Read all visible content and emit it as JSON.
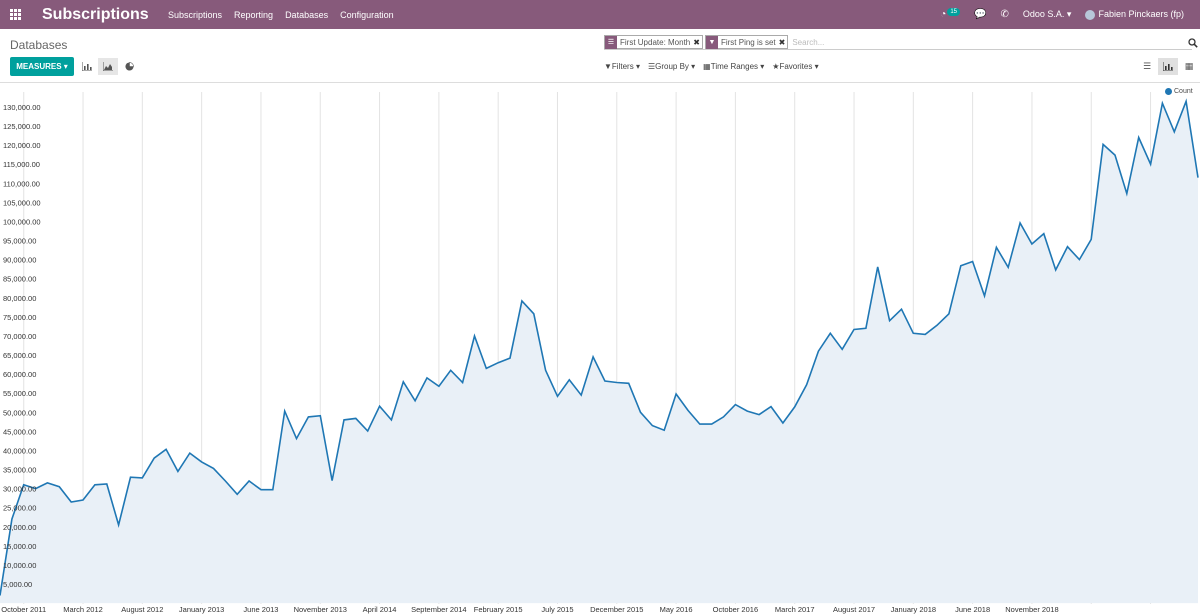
{
  "app": {
    "title": "Subscriptions",
    "menu": [
      "Subscriptions",
      "Reporting",
      "Databases",
      "Configuration"
    ],
    "activity_count": "15",
    "company": "Odoo S.A.",
    "user": "Fabien Pinckaers (fp)"
  },
  "control_panel": {
    "breadcrumb": "Databases",
    "facets": [
      {
        "icon": "menu-icon",
        "value": "First Update: Month"
      },
      {
        "icon": "filter-icon",
        "value": "First Ping is set"
      }
    ],
    "search_placeholder": "Search...",
    "measures_label": "MEASURES",
    "filters_label": "Filters",
    "groupby_label": "Group By",
    "timeranges_label": "Time Ranges",
    "favorites_label": "Favorites"
  },
  "colors": {
    "brand": "#875a7b",
    "accent": "#00a09d",
    "series": "#1f77b4",
    "fill": "#e9f0f7"
  },
  "chart_data": {
    "type": "area",
    "legend": [
      "Count"
    ],
    "legend_position": "top-right",
    "ylim": [
      0,
      132000
    ],
    "yticks": [
      5000,
      10000,
      15000,
      20000,
      25000,
      30000,
      35000,
      40000,
      45000,
      50000,
      55000,
      60000,
      65000,
      70000,
      75000,
      80000,
      85000,
      90000,
      95000,
      100000,
      105000,
      110000,
      115000,
      120000,
      125000,
      130000
    ],
    "ytick_labels": [
      "5,000.00",
      "10,000.00",
      "15,000.00",
      "20,000.00",
      "25,000.00",
      "30,000.00",
      "35,000.00",
      "40,000.00",
      "45,000.00",
      "50,000.00",
      "55,000.00",
      "60,000.00",
      "65,000.00",
      "70,000.00",
      "75,000.00",
      "80,000.00",
      "85,000.00",
      "90,000.00",
      "95,000.00",
      "100,000.00",
      "105,000.00",
      "110,000.00",
      "115,000.00",
      "120,000.00",
      "125,000.00",
      "130,000.00"
    ],
    "x_labels": [
      "October 2011",
      "March 2012",
      "August 2012",
      "January 2013",
      "June 2013",
      "November 2013",
      "April 2014",
      "September 2014",
      "February 2015",
      "July 2015",
      "December 2015",
      "May 2016",
      "October 2016",
      "March 2017",
      "August 2017",
      "January 2018",
      "June 2018",
      "November 2018"
    ],
    "series": [
      {
        "name": "Count",
        "values": [
          2000,
          22000,
          31000,
          30000,
          31500,
          30500,
          26500,
          27000,
          31000,
          31200,
          20500,
          33000,
          32800,
          38000,
          40300,
          34500,
          39300,
          37000,
          35300,
          32000,
          28500,
          32000,
          29700,
          29700,
          50300,
          43100,
          48800,
          49100,
          32100,
          48000,
          48400,
          45100,
          51600,
          48000,
          58000,
          53000,
          59000,
          56800,
          61000,
          57800,
          70000,
          61500,
          63000,
          64200,
          79200,
          75800,
          61000,
          54200,
          58500,
          54500,
          64500,
          58200,
          57800,
          57600,
          50000,
          46500,
          45300,
          54800,
          50500,
          46900,
          46900,
          48800,
          52000,
          50300,
          49400,
          51500,
          47200,
          51400,
          57200,
          66000,
          70700,
          66500,
          71700,
          72000,
          88100,
          74000,
          77000,
          70700,
          70400,
          72800,
          75800,
          88400,
          89500,
          80500,
          93200,
          88000,
          99600,
          94100,
          96800,
          87300,
          93400,
          90000,
          95300,
          120200,
          117400,
          107300,
          122000,
          115000,
          131000,
          123500,
          131500,
          111500
        ]
      }
    ]
  }
}
